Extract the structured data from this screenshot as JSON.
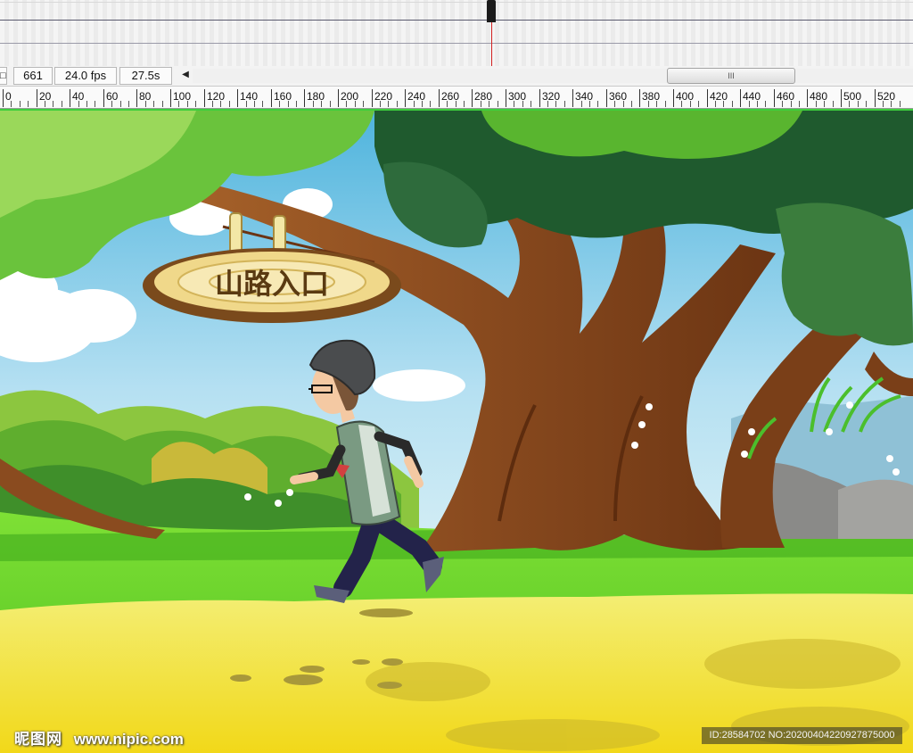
{
  "status_bar": {
    "frame": "661",
    "fps": "24.0 fps",
    "time": "27.5s",
    "scroll_thumb_grip": "III"
  },
  "ruler": {
    "labels": [
      "0",
      "20",
      "40",
      "60",
      "80",
      "100",
      "120",
      "140",
      "160",
      "180",
      "200",
      "220",
      "240",
      "260",
      "280",
      "300",
      "320",
      "340",
      "360",
      "380",
      "400",
      "420",
      "440",
      "460",
      "480",
      "500",
      "520"
    ]
  },
  "scene": {
    "sign_text": "山路入口"
  },
  "watermark": {
    "left_logo": "昵图网",
    "left_site": "www.nipic.com",
    "right_text": "ID:28584702 NO:20200404220927875000"
  },
  "colors": {
    "sky": "#9fd3ee",
    "grass": "#5fd12b",
    "path": "#f2e23a",
    "trunk": "#8a4b1f",
    "foliage": "#3f8f2a",
    "playhead": "#d22020",
    "stage_border": "#3dcf3d"
  }
}
